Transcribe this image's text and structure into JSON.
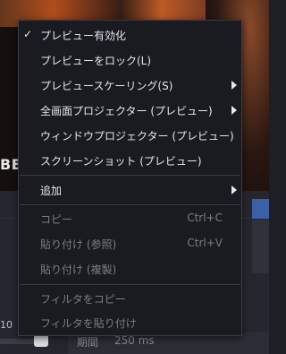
{
  "background": {
    "preview_text": "BEN",
    "slider_value_text": "10",
    "field_label": "期間",
    "field_value": "250 ms"
  },
  "menu": {
    "items": [
      {
        "label": "プレビュー有効化",
        "checked": true,
        "check_glyph": "✓"
      },
      {
        "label": "プレビューをロック(L)"
      },
      {
        "label": "プレビュースケーリング(S)",
        "submenu": true
      },
      {
        "label": "全画面プロジェクター (プレビュー)",
        "submenu": true
      },
      {
        "label": "ウィンドウプロジェクター (プレビュー)"
      },
      {
        "label": "スクリーンショット (プレビュー)"
      },
      {
        "label": "追加",
        "submenu": true
      },
      {
        "label": "コピー",
        "shortcut": "Ctrl+C",
        "disabled": true
      },
      {
        "label": "貼り付け (参照)",
        "shortcut": "Ctrl+V",
        "disabled": true
      },
      {
        "label": "貼り付け (複製)",
        "disabled": true
      },
      {
        "label": "フィルタをコピー",
        "disabled": true
      },
      {
        "label": "フィルタを貼り付け",
        "disabled": true
      }
    ]
  }
}
